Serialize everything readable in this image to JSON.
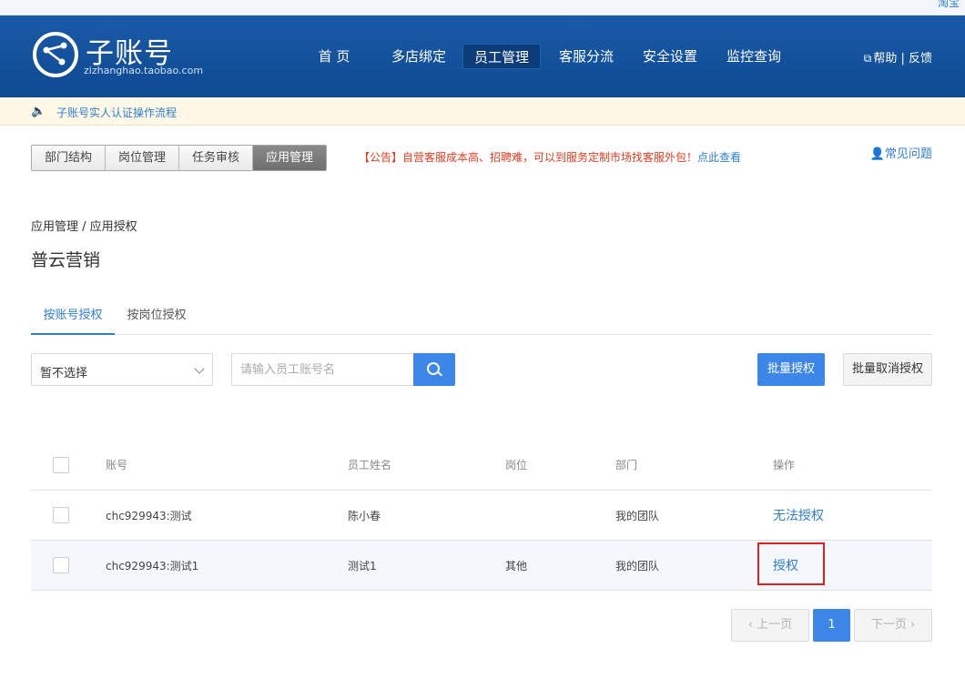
{
  "topstrip": {
    "corner_text": "淘宝"
  },
  "header": {
    "brand": "子账号",
    "domain": "zizhanghao.taobao.com",
    "nav": [
      {
        "label": "首 页"
      },
      {
        "label": "多店绑定"
      },
      {
        "label": "员工管理"
      },
      {
        "label": "客服分流"
      },
      {
        "label": "安全设置"
      },
      {
        "label": "监控查询"
      }
    ],
    "help_label": "帮助 | 反馈"
  },
  "notice": {
    "text": "子账号实人认证操作流程"
  },
  "tabs": [
    {
      "label": "部门结构"
    },
    {
      "label": "岗位管理"
    },
    {
      "label": "任务审核"
    },
    {
      "label": "应用管理"
    }
  ],
  "announcement": {
    "text": "【公告】自营客服成本高、招聘难，可以到服务定制市场找客服外包！",
    "link": "点此查看"
  },
  "faq": {
    "label": "常见问题"
  },
  "breadcrumb": "应用管理 / 应用授权",
  "app_title": "普云营销",
  "subtabs": [
    {
      "label": "按账号授权"
    },
    {
      "label": "按岗位授权"
    }
  ],
  "filter": {
    "select_value": "暂不选择",
    "search_placeholder": "请输入员工账号名"
  },
  "actions": {
    "batch_grant": "批量授权",
    "batch_revoke": "批量取消授权"
  },
  "table": {
    "headers": {
      "account": "账号",
      "name": "员工姓名",
      "position": "岗位",
      "department": "部门",
      "operation": "操作"
    },
    "rows": [
      {
        "account": "chc929943:测试",
        "name": "陈小春",
        "position": "",
        "department": "我的团队",
        "operation": "无法授权"
      },
      {
        "account": "chc929943:测试1",
        "name": "测试1",
        "position": "其他",
        "department": "我的团队",
        "operation": "授权"
      }
    ]
  },
  "pagination": {
    "prev": "上一页",
    "current": "1",
    "next": "下一页"
  }
}
